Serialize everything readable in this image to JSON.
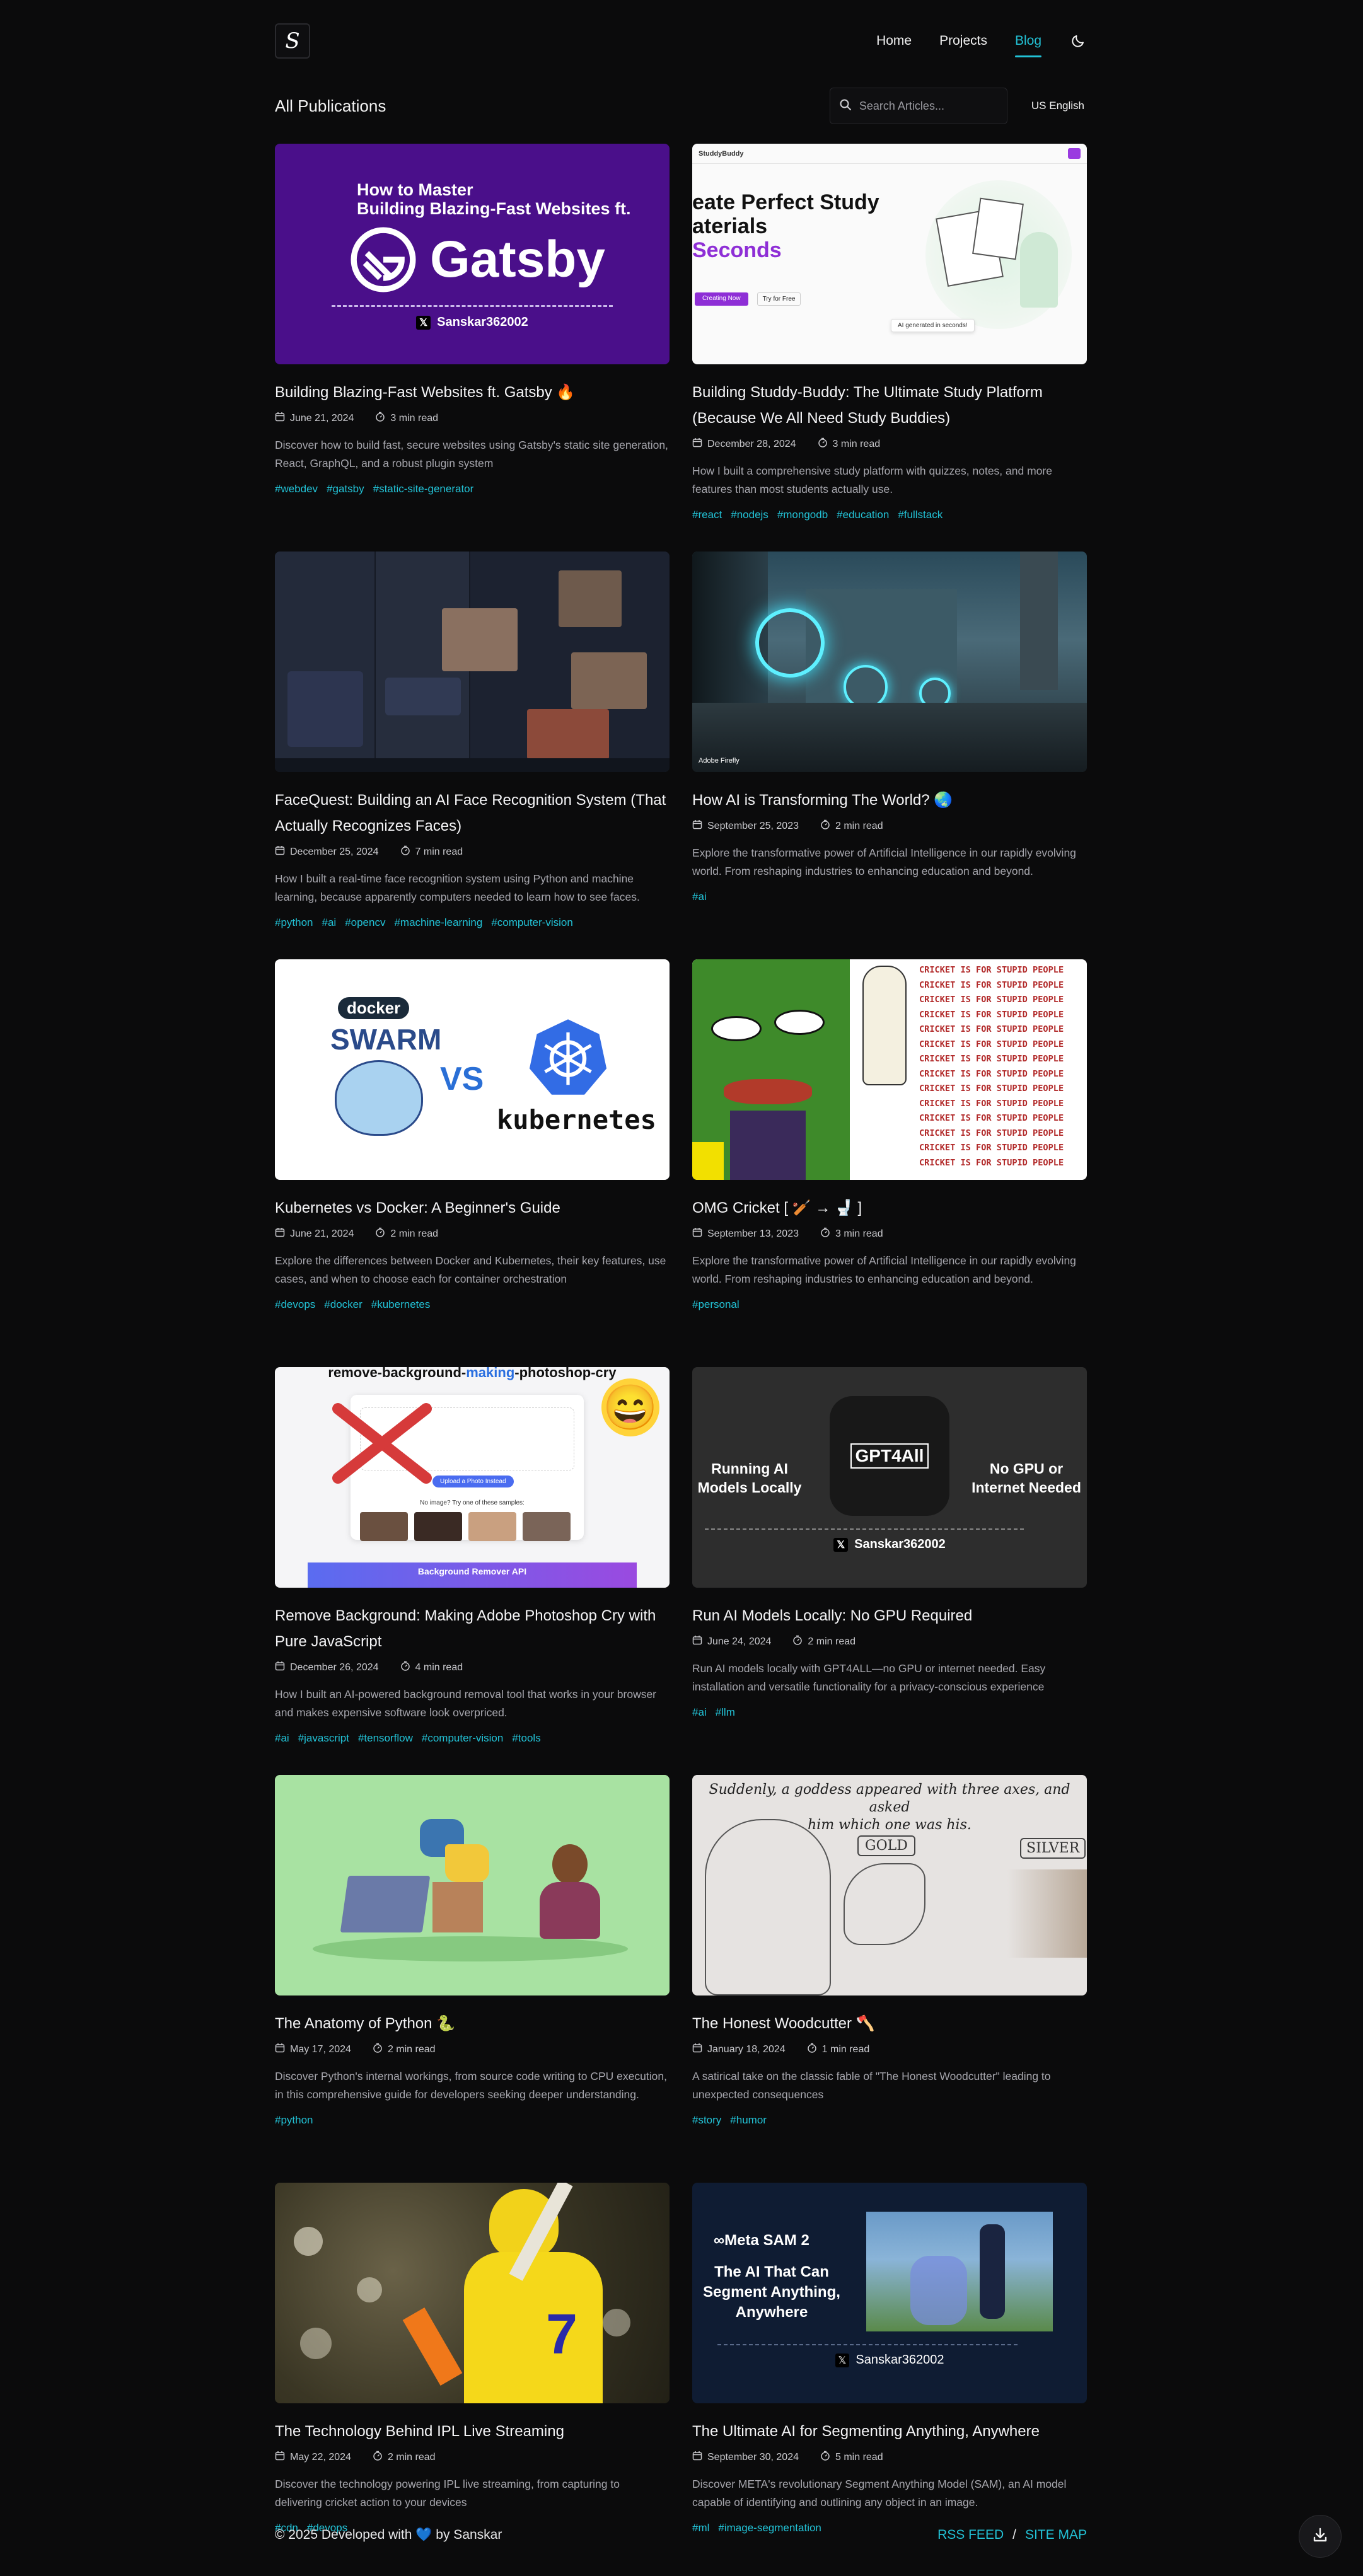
{
  "header": {
    "logo_letter": "S",
    "nav": [
      {
        "label": "Home",
        "active": false
      },
      {
        "label": "Projects",
        "active": false
      },
      {
        "label": "Blog",
        "active": true
      }
    ],
    "theme_icon": "moon-icon"
  },
  "page": {
    "title": "All Publications",
    "search_placeholder": "Search Articles...",
    "language": "US English"
  },
  "colors": {
    "accent": "#22c2d6",
    "background": "#0b0b0c"
  },
  "posts": [
    {
      "title": "Building Blazing-Fast Websites ft. Gatsby 🔥",
      "date": "June 21, 2024",
      "read_time": "3 min read",
      "description": "Discover how to build fast, secure websites using Gatsby's static site generation, React, GraphQL, and a robust plugin system",
      "tags": [
        "#webdev",
        "#gatsby",
        "#static-site-generator"
      ],
      "thumb": {
        "line1": "How to Master",
        "line2": "Building Blazing-Fast Websites ft.",
        "brand": "Gatsby",
        "handle": "Sanskar362002"
      }
    },
    {
      "title": "Building Studdy-Buddy: The Ultimate Study Platform (Because We All Need Study Buddies)",
      "date": "December 28, 2024",
      "read_time": "3 min read",
      "description": "How I built a comprehensive study platform with quizzes, notes, and more features than most students actually use.",
      "tags": [
        "#react",
        "#nodejs",
        "#mongodb",
        "#education",
        "#fullstack"
      ],
      "thumb": {
        "brand": "StuddyBuddy",
        "headline1": "eate Perfect Study",
        "headline2": "aterials",
        "headline3": "Seconds",
        "cta1": "Creating Now",
        "cta2": "Try for Free",
        "badge": "AI generated in seconds!"
      }
    },
    {
      "title": "FaceQuest: Building an AI Face Recognition System (That Actually Recognizes Faces)",
      "date": "December 25, 2024",
      "read_time": "7 min read",
      "description": "How I built a real-time face recognition system using Python and machine learning, because apparently computers needed to learn how to see faces.",
      "tags": [
        "#python",
        "#ai",
        "#opencv",
        "#machine-learning",
        "#computer-vision"
      ],
      "thumb": {}
    },
    {
      "title": "How AI is Transforming The World? 🌏",
      "date": "September 25, 2023",
      "read_time": "2 min read",
      "description": "Explore the transformative power of Artificial Intelligence in our rapidly evolving world. From reshaping industries to enhancing education and beyond.",
      "tags": [
        "#ai"
      ],
      "thumb": {
        "badge": "Adobe Firefly"
      }
    },
    {
      "title": "Kubernetes vs Docker: A Beginner's Guide",
      "date": "June 21, 2024",
      "read_time": "2 min read",
      "description": "Explore the differences between Docker and Kubernetes, their key features, use cases, and when to choose each for container orchestration",
      "tags": [
        "#devops",
        "#docker",
        "#kubernetes"
      ],
      "thumb": {
        "left_top": "docker",
        "left_main": "SWARM",
        "vs": "VS",
        "right": "kubernetes"
      }
    },
    {
      "title": "OMG Cricket [ 🏏 → 🚽 ]",
      "date": "September 13, 2023",
      "read_time": "3 min read",
      "description": "Explore the transformative power of Artificial Intelligence in our rapidly evolving world. From reshaping industries to enhancing education and beyond.",
      "tags": [
        "#personal"
      ],
      "thumb": {
        "repeat_text": "CRICKET IS FOR STUPID PEOPLE"
      }
    },
    {
      "title": "Remove Background: Making Adobe Photoshop Cry with Pure JavaScript",
      "date": "December 26, 2024",
      "read_time": "4 min read",
      "description": "How I built an AI-powered background removal tool that works in your browser and makes expensive software look overpriced.",
      "tags": [
        "#ai",
        "#javascript",
        "#tensorflow",
        "#computer-vision",
        "#tools"
      ],
      "thumb": {
        "top_text_a": "remove-background-",
        "top_text_b": "making",
        "top_text_c": "-photoshop-cry",
        "upload_label": "Upload a Photo Instead",
        "try_label": "No image? Try one of these samples:",
        "bottom_bar": "Background Remover API"
      }
    },
    {
      "title": "Run AI Models Locally: No GPU Required",
      "date": "June 24, 2024",
      "read_time": "2 min read",
      "description": "Run AI models locally with GPT4ALL—no GPU or internet needed. Easy installation and versatile functionality for a privacy-conscious experience",
      "tags": [
        "#ai",
        "#llm"
      ],
      "thumb": {
        "left": "Running AI Models Locally",
        "center": "GPT4All",
        "right": "No GPU or Internet Needed",
        "handle": "Sanskar362002"
      }
    },
    {
      "title": "The Anatomy of Python 🐍",
      "date": "May 17, 2024",
      "read_time": "2 min read",
      "description": "Discover Python's internal workings, from source code writing to CPU execution, in this comprehensive guide for developers seeking deeper understanding.",
      "tags": [
        "#python"
      ],
      "thumb": {}
    },
    {
      "title": "The Honest Woodcutter 🪓",
      "date": "January 18, 2024",
      "read_time": "1 min read",
      "description": "A satirical take on the classic fable of \"The Honest Woodcutter\" leading to unexpected consequences",
      "tags": [
        "#story",
        "#humor"
      ],
      "thumb": {
        "caption1": "Suddenly, a goddess appeared with three axes, and asked",
        "caption2": "him which one was his.",
        "gold": "GOLD",
        "silver": "SILVER"
      }
    },
    {
      "title": "The Technology Behind IPL Live Streaming",
      "date": "May 22, 2024",
      "read_time": "2 min read",
      "description": "Discover the technology powering IPL live streaming, from capturing to delivering cricket action to your devices",
      "tags": [
        "#cdn",
        "#devops"
      ],
      "thumb": {
        "jersey_number": "7"
      }
    },
    {
      "title": "The Ultimate AI for Segmenting Anything, Anywhere",
      "date": "September 30, 2024",
      "read_time": "5 min read",
      "description": "Discover META's revolutionary Segment Anything Model (SAM), an AI model capable of identifying and outlining any object in an image.",
      "tags": [
        "#ml",
        "#image-segmentation"
      ],
      "thumb": {
        "brand": "∞Meta SAM 2",
        "line1": "The AI That Can",
        "line2": "Segment Anything,",
        "line3": "Anywhere",
        "handle": "Sanskar362002"
      }
    }
  ],
  "footer": {
    "text_a": "© 2025 Developed with",
    "heart": "💙",
    "text_b": "by Sanskar",
    "links": [
      "RSS FEED",
      "SITE MAP"
    ],
    "divider": "/"
  }
}
